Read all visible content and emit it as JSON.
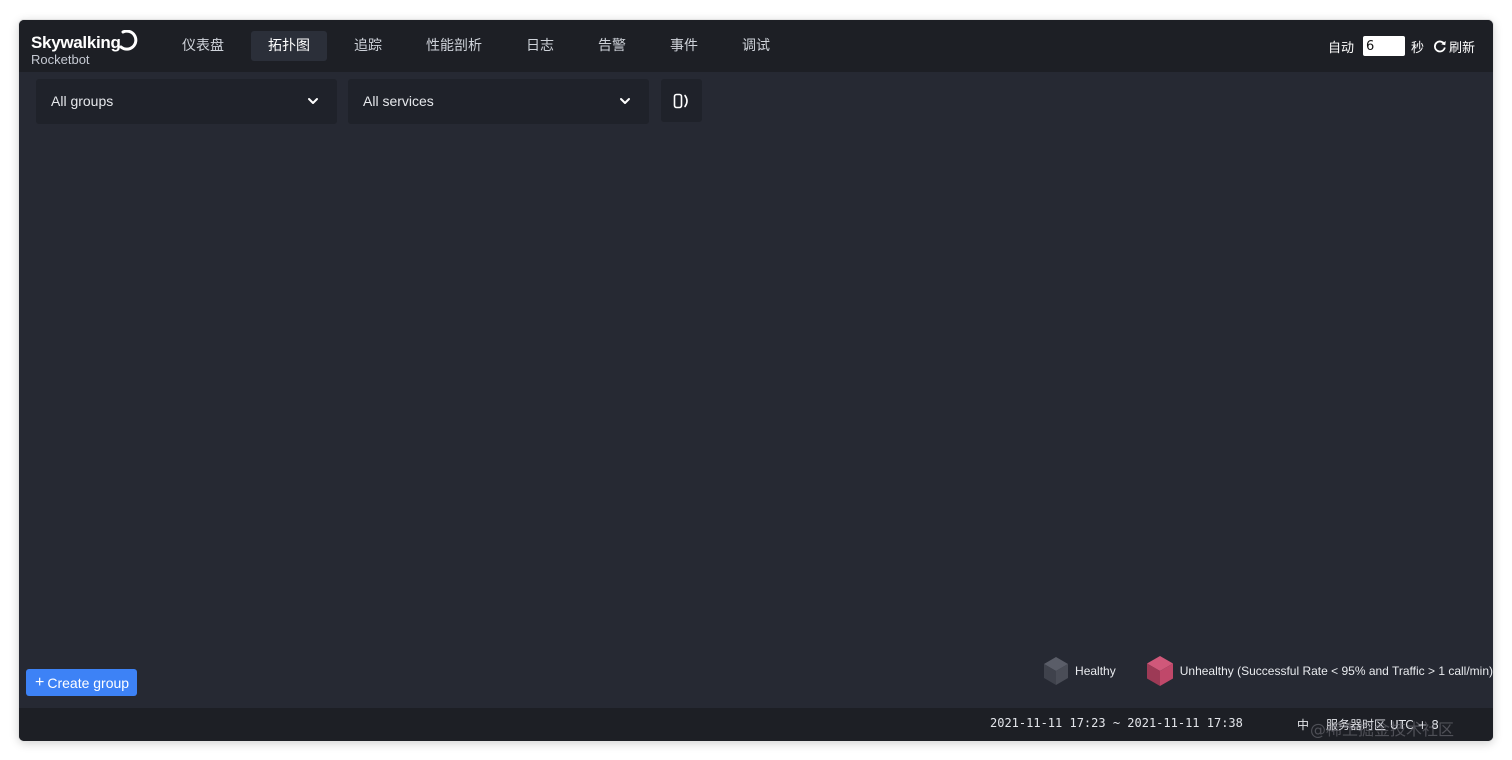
{
  "header": {
    "logo_title": "Skywalking",
    "logo_subtitle": "Rocketbot",
    "nav": [
      {
        "label": "仪表盘",
        "active": false
      },
      {
        "label": "拓扑图",
        "active": true
      },
      {
        "label": "追踪",
        "active": false
      },
      {
        "label": "性能剖析",
        "active": false
      },
      {
        "label": "日志",
        "active": false
      },
      {
        "label": "告警",
        "active": false
      },
      {
        "label": "事件",
        "active": false
      },
      {
        "label": "调试",
        "active": false
      }
    ],
    "auto_label": "自动",
    "interval_value": "6",
    "seconds_label": "秒",
    "refresh_label": "刷新"
  },
  "toolbar": {
    "group_select": "All groups",
    "service_select": "All services"
  },
  "legend": {
    "healthy": "Healthy",
    "unhealthy": "Unhealthy (Successful Rate < 95% and Traffic > 1 call/min)",
    "healthy_color": "#4a4d57",
    "unhealthy_color": "#c0486a"
  },
  "create_group_label": "Create group",
  "footer": {
    "time_range": "2021-11-11 17:23 ~ 2021-11-11 17:38",
    "language": "中",
    "timezone": "服务器时区 UTC + 8"
  },
  "watermark": "@稀土掘金技术社区",
  "colors": {
    "background": "#262933",
    "header": "#1d1f25",
    "accent": "#3d82f6"
  }
}
